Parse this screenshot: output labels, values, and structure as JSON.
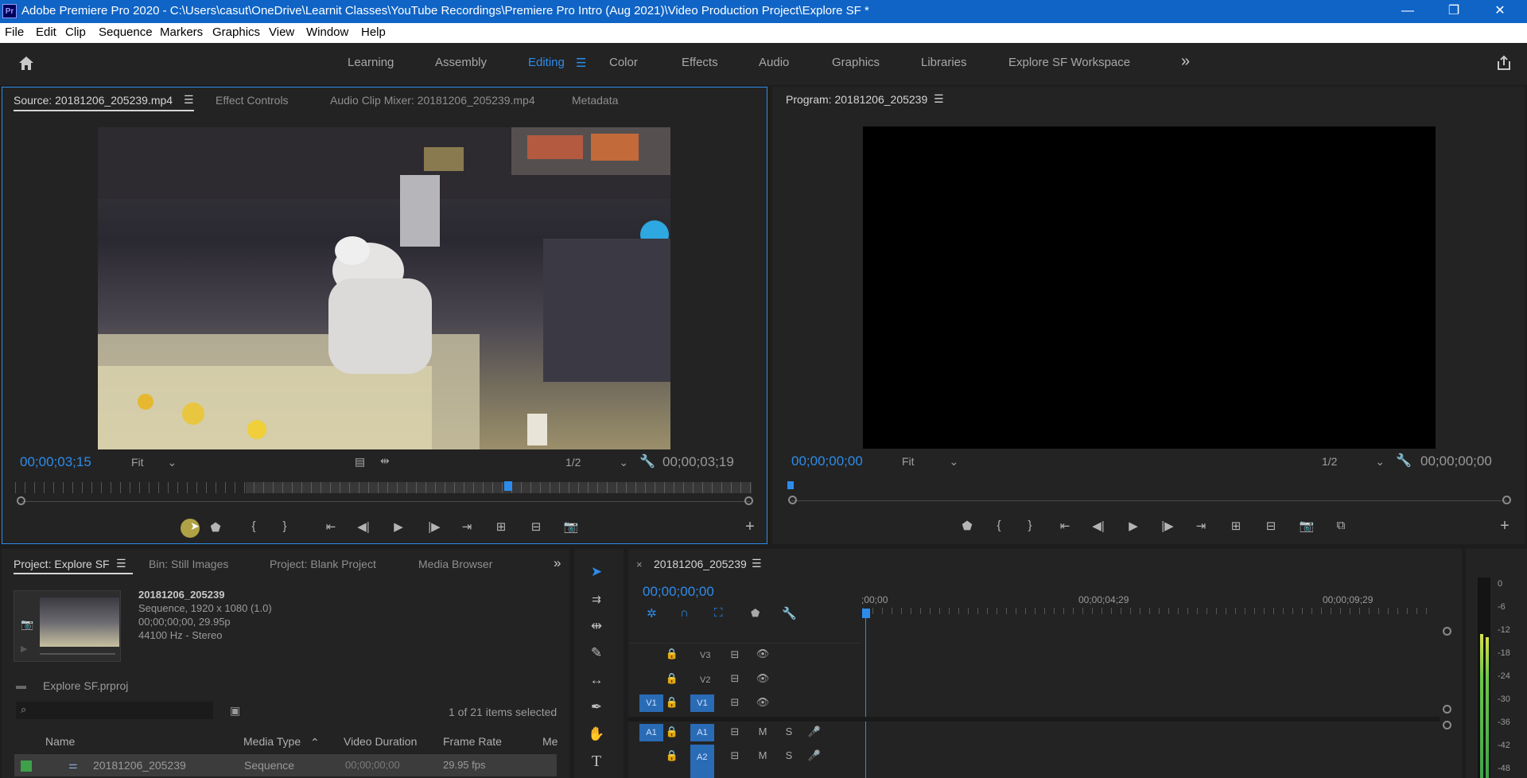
{
  "window": {
    "app_icon": "Pr",
    "title": "Adobe Premiere Pro 2020 - C:\\Users\\casut\\OneDrive\\Learnit Classes\\YouTube Recordings\\Premiere Pro Intro (Aug 2021)\\Video Production Project\\Explore SF *",
    "minimize": "—",
    "restore": "❐",
    "close": "✕"
  },
  "menu": [
    "File",
    "Edit",
    "Clip",
    "Sequence",
    "Markers",
    "Graphics",
    "View",
    "Window",
    "Help"
  ],
  "workspaces": {
    "items": [
      "Learning",
      "Assembly",
      "Editing",
      "Color",
      "Effects",
      "Audio",
      "Graphics",
      "Libraries",
      "Explore SF Workspace"
    ],
    "active": "Editing",
    "overflow": "»"
  },
  "source_panel": {
    "tabs": [
      "Source: 20181206_205239.mp4",
      "Effect Controls",
      "Audio Clip Mixer: 20181206_205239.mp4",
      "Metadata"
    ],
    "current_timecode": "00;00;03;15",
    "zoom": "Fit",
    "resolution": "1/2",
    "duration_timecode": "00;00;03;19",
    "playhead_fraction": 0.67
  },
  "program_panel": {
    "tab": "Program: 20181206_205239",
    "current_timecode": "00;00;00;00",
    "zoom": "Fit",
    "resolution": "1/2",
    "duration_timecode": "00;00;00;00"
  },
  "project_panel": {
    "tabs": [
      "Project: Explore SF",
      "Bin: Still Images",
      "Project: Blank Project",
      "Media Browser"
    ],
    "overflow": "»",
    "clip_name": "20181206_205239",
    "clip_info": [
      "Sequence, 1920 x 1080 (1.0)",
      "00;00;00;00, 29.95p",
      "44100 Hz - Stereo"
    ],
    "project_file": "Explore SF.prproj",
    "items_selected": "1 of 21 items selected",
    "columns": [
      "Name",
      "Media Type",
      "Video Duration",
      "Frame Rate",
      "Me"
    ],
    "rows": [
      {
        "name": "20181206_205239",
        "media_type": "Sequence",
        "video_duration": "00;00;00;00",
        "frame_rate": "29.95 fps",
        "color": "#3fa04a"
      }
    ]
  },
  "timeline": {
    "tab": "20181206_205239",
    "current_timecode": "00;00;00;00",
    "ruler_labels": [
      ";00;00",
      "00;00;04;29",
      "00;00;09;29"
    ],
    "video_tracks": [
      "V3",
      "V2",
      "V1"
    ],
    "audio_tracks": [
      "A1",
      "A2"
    ],
    "source_video": "V1",
    "source_audio": "A1",
    "mute_label": "M",
    "solo_label": "S"
  },
  "audio_meter": {
    "scale": [
      "0",
      "-6",
      "-12",
      "-18",
      "-24",
      "-30",
      "-36",
      "-42",
      "-48"
    ],
    "level_fraction": 0.72
  },
  "colors": {
    "accent": "#2d8ceb",
    "titlebar": "#0f64c6",
    "panel": "#232323",
    "track_target": "#2a6bb5"
  }
}
